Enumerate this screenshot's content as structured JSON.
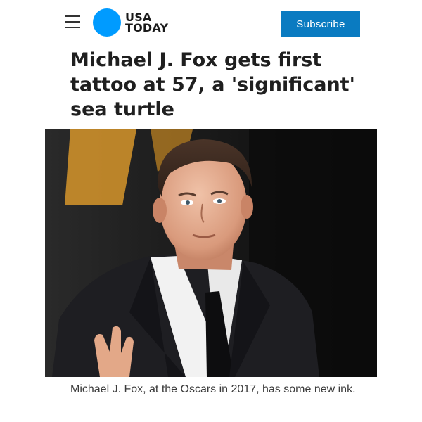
{
  "header": {
    "menu_icon": "hamburger-menu-icon",
    "logo_line1": "USA",
    "logo_line2": "TODAY",
    "logo_color": "#009bff",
    "subscribe_label": "Subscribe",
    "subscribe_color": "#0a7bc1"
  },
  "article": {
    "headline": "Michael J. Fox gets first tattoo at 57, a 'significant' sea turtle",
    "photo_caption": "Michael J. Fox, at the Oscars in 2017, has some new ink."
  }
}
